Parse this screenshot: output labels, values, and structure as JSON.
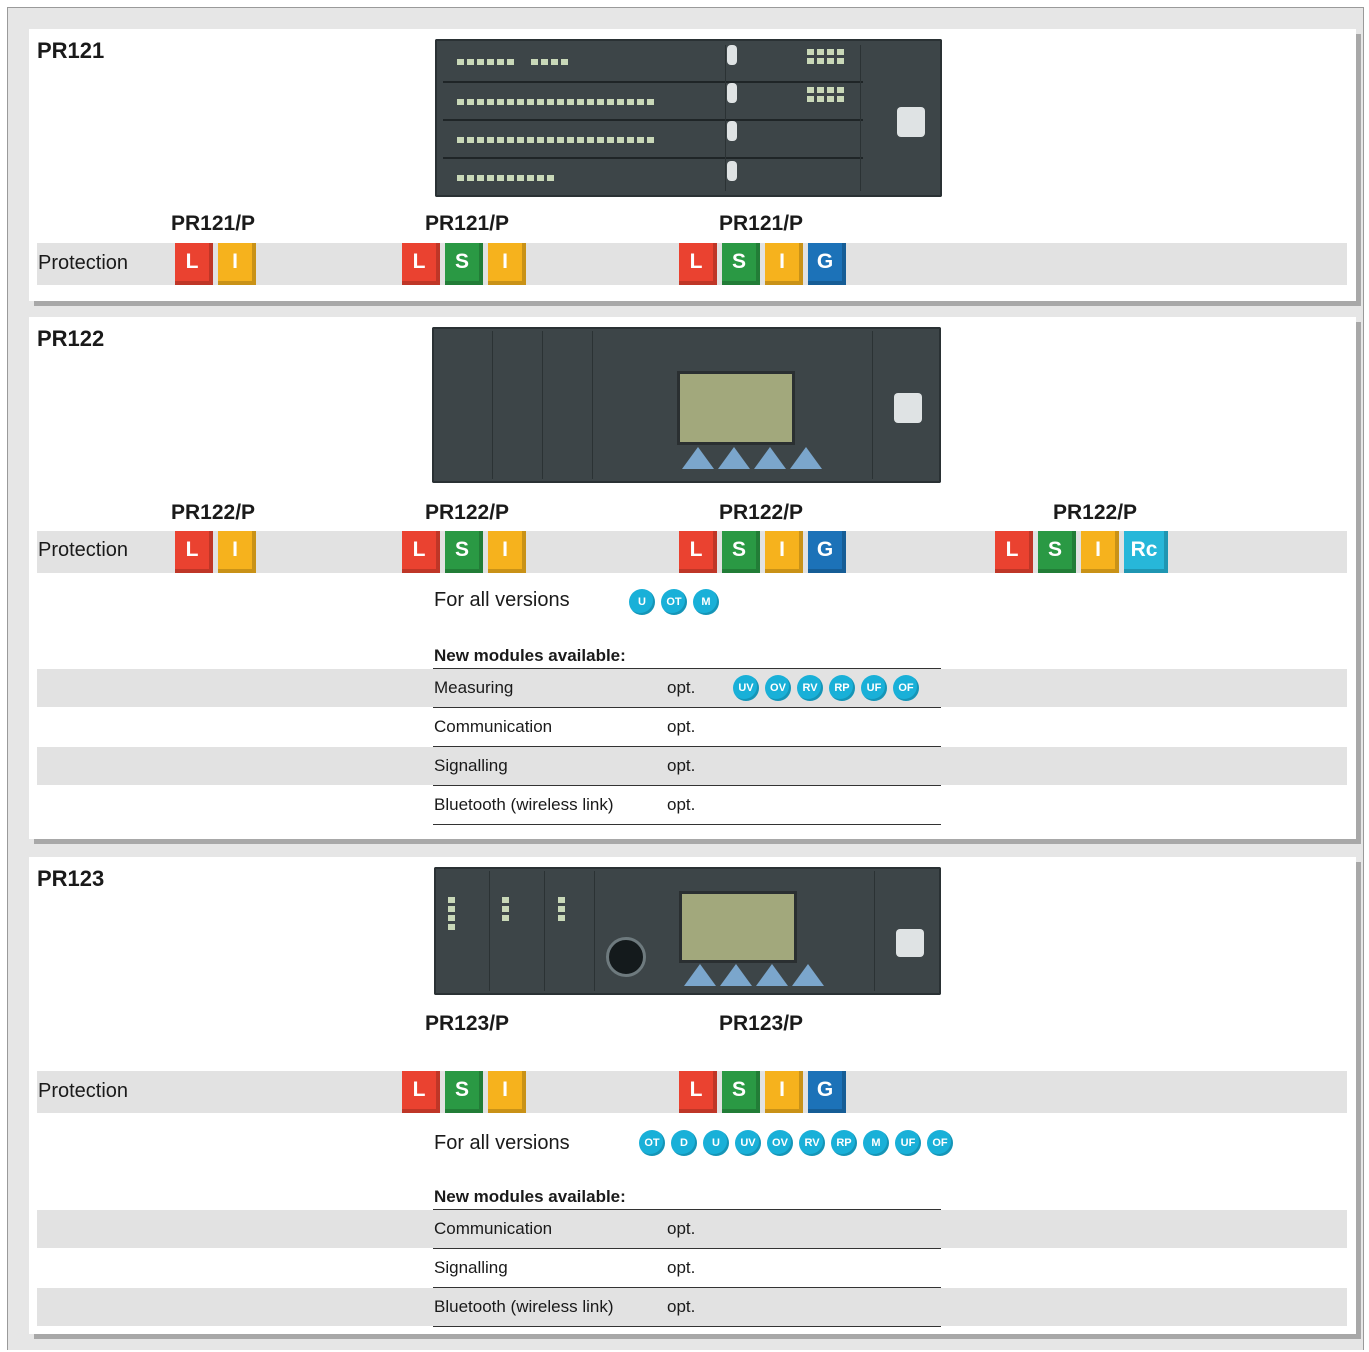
{
  "pr121": {
    "title": "PR121",
    "protection_label": "Protection",
    "variants": [
      {
        "name": "PR121/P",
        "badges": [
          "L",
          "I"
        ]
      },
      {
        "name": "PR121/P",
        "badges": [
          "L",
          "S",
          "I"
        ]
      },
      {
        "name": "PR121/P",
        "badges": [
          "L",
          "S",
          "I",
          "G"
        ]
      }
    ]
  },
  "pr122": {
    "title": "PR122",
    "protection_label": "Protection",
    "variants": [
      {
        "name": "PR122/P",
        "badges": [
          "L",
          "I"
        ]
      },
      {
        "name": "PR122/P",
        "badges": [
          "L",
          "S",
          "I"
        ]
      },
      {
        "name": "PR122/P",
        "badges": [
          "L",
          "S",
          "I",
          "G"
        ]
      },
      {
        "name": "PR122/P",
        "badges": [
          "L",
          "S",
          "I",
          "Rc"
        ]
      }
    ],
    "all_versions_label": "For all versions",
    "all_versions": [
      "U",
      "OT",
      "M"
    ],
    "modules_heading": "New modules available:",
    "modules": [
      {
        "name": "Measuring",
        "opt": "opt.",
        "icons": [
          "UV",
          "OV",
          "RV",
          "RP",
          "UF",
          "OF"
        ]
      },
      {
        "name": "Communication",
        "opt": "opt."
      },
      {
        "name": "Signalling",
        "opt": "opt."
      },
      {
        "name": "Bluetooth (wireless link)",
        "opt": "opt."
      }
    ]
  },
  "pr123": {
    "title": "PR123",
    "protection_label": "Protection",
    "variants": [
      {
        "name": "PR123/P",
        "badges": [
          "L",
          "S",
          "I"
        ]
      },
      {
        "name": "PR123/P",
        "badges": [
          "L",
          "S",
          "I",
          "G"
        ]
      }
    ],
    "all_versions_label": "For all versions",
    "all_versions": [
      "OT",
      "D",
      "U",
      "UV",
      "OV",
      "RV",
      "RP",
      "M",
      "UF",
      "OF"
    ],
    "modules_heading": "New modules available:",
    "modules": [
      {
        "name": "Communication",
        "opt": "opt."
      },
      {
        "name": "Signalling",
        "opt": "opt."
      },
      {
        "name": "Bluetooth (wireless link)",
        "opt": "opt."
      }
    ]
  },
  "colors": {
    "L": "#ea4230",
    "S": "#2a9944",
    "I": "#f6b21d",
    "G": "#1c72b8",
    "Rc": "#27b7d9",
    "module_circle": "#19b0d8",
    "band": "#e2e2e2"
  }
}
